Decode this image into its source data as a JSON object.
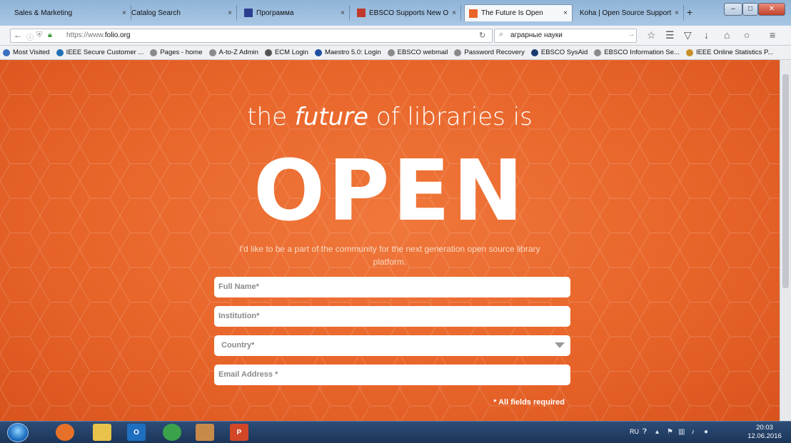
{
  "browser": {
    "tabs": [
      {
        "label": "Sales & Marketing",
        "active": false
      },
      {
        "label": "Catalog Search",
        "active": false
      },
      {
        "label": "Программа",
        "active": false
      },
      {
        "label": "EBSCO Supports New O...",
        "active": false
      },
      {
        "label": "The Future Is Open",
        "active": true
      },
      {
        "label": "Koha | Open Source Support...",
        "active": false
      }
    ],
    "new_tab": "+",
    "close_glyph": "×",
    "url_prefix": "https://www.",
    "url_domain": "folio.org",
    "search_value": "аграрные науки",
    "bookmarks": [
      {
        "label": "Most Visited",
        "icon": "star-icon",
        "color": "#3a6fc0"
      },
      {
        "label": "IEEE Secure Customer ...",
        "icon": "ieee-icon",
        "color": "#1f6fb3"
      },
      {
        "label": "Pages - home",
        "icon": "globe-icon",
        "color": "#8a8a8a"
      },
      {
        "label": "A-to-Z Admin",
        "icon": "globe-icon",
        "color": "#8a8a8a"
      },
      {
        "label": "ECM Login",
        "icon": "document-icon",
        "color": "#555555"
      },
      {
        "label": "Maestro 5.0: Login",
        "icon": "x-icon",
        "color": "#1e4fa1"
      },
      {
        "label": "EBSCO webmail",
        "icon": "globe-icon",
        "color": "#8a8a8a"
      },
      {
        "label": "Password Recovery",
        "icon": "globe-icon",
        "color": "#8a8a8a"
      },
      {
        "label": "EBSCO SysAid",
        "icon": "sysaid-icon",
        "color": "#1b3b6e"
      },
      {
        "label": "EBSCO Information Se...",
        "icon": "globe-icon",
        "color": "#8a8a8a"
      },
      {
        "label": "IEEE Online Statistics P...",
        "icon": "ieee-icon",
        "color": "#c8902a"
      }
    ]
  },
  "page": {
    "headline_pre": "the ",
    "headline_em": "future",
    "headline_post": " of libraries is",
    "big_word": "OPEN",
    "tagline": "I'd like to be a part of the community for the next generation open source library platform.",
    "fields": {
      "full_name": "Full Name*",
      "institution": "Institution*",
      "country": "Country*",
      "email": "Email Address *"
    },
    "required_note": "* All fields required",
    "accent_color": "#e8652a"
  },
  "taskbar": {
    "apps": [
      {
        "name": "firefox-icon",
        "label": "",
        "color": "#e8712a"
      },
      {
        "name": "file-explorer-icon",
        "label": "",
        "color": "#e8c24a"
      },
      {
        "name": "outlook-icon",
        "label": "O",
        "color": "#1f6fc0"
      },
      {
        "name": "chrome-icon",
        "label": "",
        "color": "#3aa24a"
      },
      {
        "name": "app-icon",
        "label": "",
        "color": "#c88a4a"
      },
      {
        "name": "powerpoint-icon",
        "label": "P",
        "color": "#d24726"
      }
    ],
    "language": "RU",
    "time": "20:03",
    "date": "12.06.2016"
  }
}
